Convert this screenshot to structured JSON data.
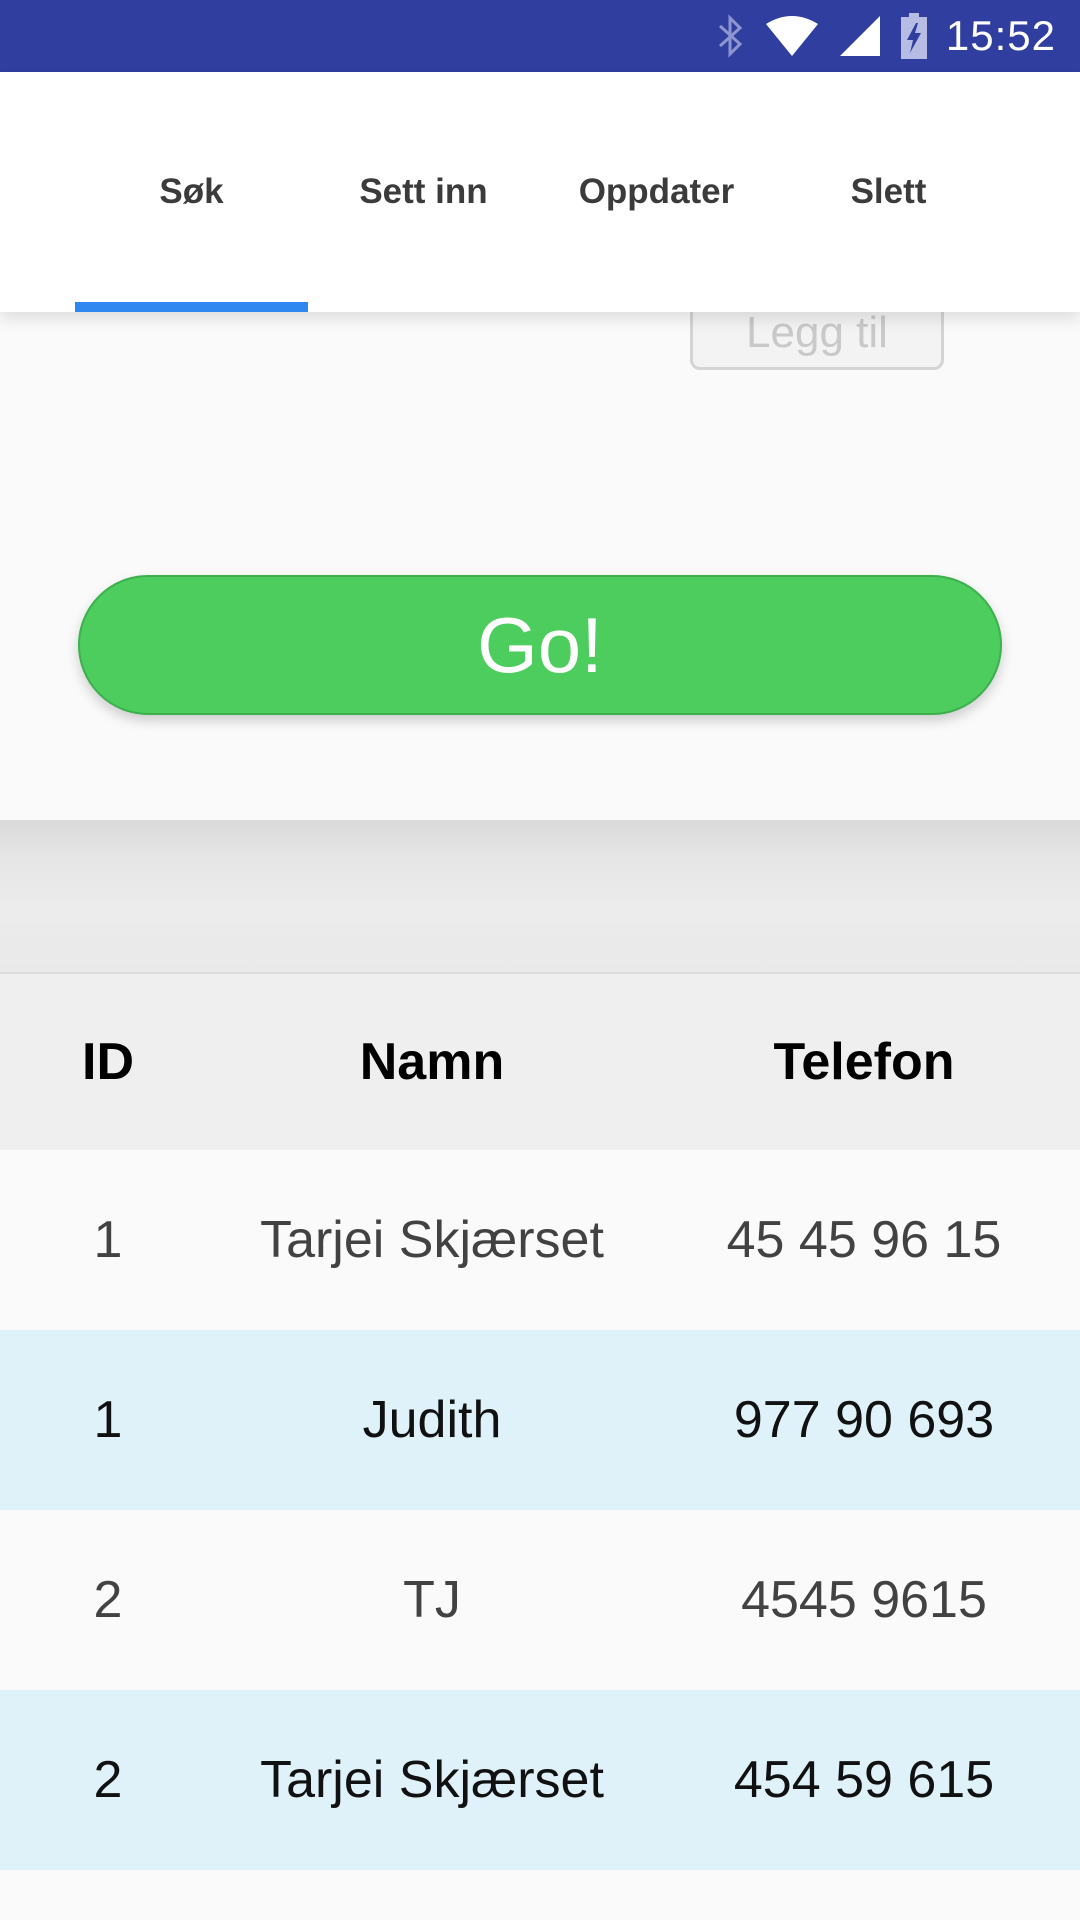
{
  "status_bar": {
    "time": "15:52",
    "icons": [
      "bluetooth-icon",
      "wifi-icon",
      "signal-icon",
      "battery-charging-icon"
    ]
  },
  "tabs": [
    {
      "label": "Søk",
      "selected": true
    },
    {
      "label": "Sett inn",
      "selected": false
    },
    {
      "label": "Oppdater",
      "selected": false
    },
    {
      "label": "Slett",
      "selected": false
    }
  ],
  "legg_til_label": "Legg til",
  "go_label": "Go!",
  "colors": {
    "status_bar": "#303f9f",
    "tab_indicator": "#2f88f0",
    "go_button": "#4ccd5e",
    "row_highlight": "#dff1f9"
  },
  "table": {
    "headers": [
      "ID",
      "Namn",
      "Telefon"
    ],
    "rows": [
      {
        "id": "1",
        "name": "Tarjei Skjærset",
        "phone": "45 45 96 15"
      },
      {
        "id": "1",
        "name": "Judith",
        "phone": "977 90 693"
      },
      {
        "id": "2",
        "name": "TJ",
        "phone": "4545 9615"
      },
      {
        "id": "2",
        "name": "Tarjei Skjærset",
        "phone": "454 59 615"
      }
    ]
  }
}
